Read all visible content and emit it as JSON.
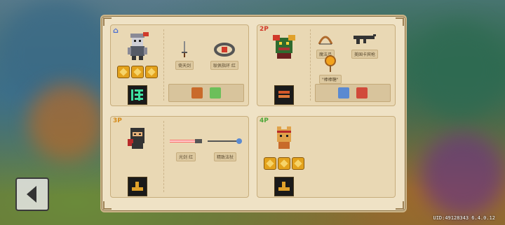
{
  "players": [
    {
      "tag": "",
      "weapons": [
        "倚天剑",
        "耿佩指环 红"
      ]
    },
    {
      "tag": "2P",
      "weapons": [
        "魔法弓",
        "美国卡宾枪",
        "\"棒棒糖\""
      ]
    },
    {
      "tag": "3P",
      "weapons": [
        "光剑 红",
        "精致法杖"
      ]
    },
    {
      "tag": "4P",
      "weapons": []
    }
  ],
  "footer": {
    "uid": "UID:49128343 6.4.0.12"
  },
  "colors": {
    "panel": "#efe2c5",
    "card": "#e9d8b4",
    "p1": "#4c6fd1",
    "p2": "#d13a2a",
    "p3": "#d58b1a",
    "p4": "#4fa83a"
  },
  "icons": {
    "back": "back-arrow-icon",
    "buff": "gold-buff-icon",
    "p1_marker": "p1-house-icon"
  }
}
